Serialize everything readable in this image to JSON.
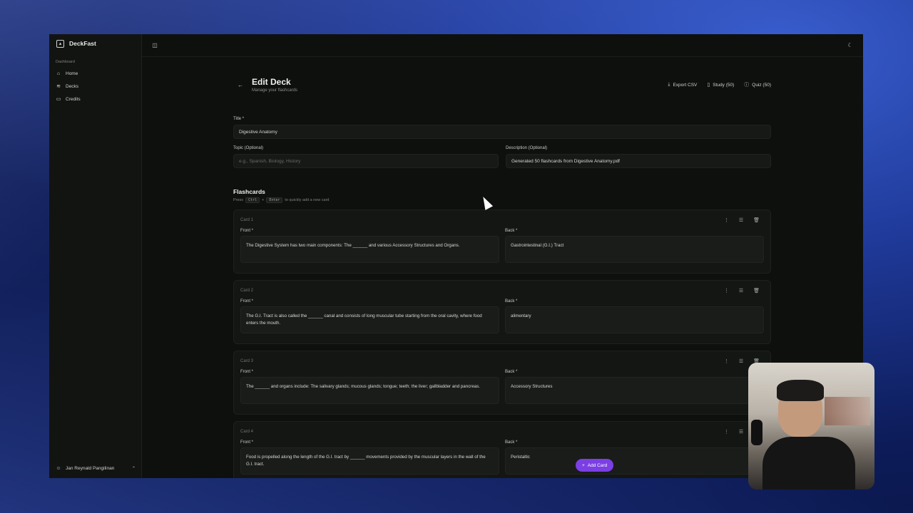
{
  "app": {
    "name": "DeckFast"
  },
  "sidebar": {
    "section_label": "Dashboard",
    "items": [
      {
        "label": "Home",
        "icon": "home-icon"
      },
      {
        "label": "Decks",
        "icon": "layers-icon"
      },
      {
        "label": "Credits",
        "icon": "credit-card-icon"
      }
    ],
    "user_name": "Jan Reynald Pangilinan"
  },
  "header": {
    "title": "Edit Deck",
    "subtitle": "Manage your flashcards",
    "actions": {
      "export": "Export CSV",
      "study": "Study (50)",
      "quiz": "Quiz (50)"
    }
  },
  "form": {
    "title_label": "Title *",
    "title_value": "Digestive Anatomy",
    "topic_label": "Topic (Optional)",
    "topic_placeholder": "e.g., Spanish, Biology, History",
    "description_label": "Description (Optional)",
    "description_value": "Generated 50 flashcards from Digestive Anatomy.pdf"
  },
  "flashcards": {
    "title": "Flashcards",
    "hint_prefix": "Press",
    "hint_key1": "Ctrl",
    "hint_plus": "+",
    "hint_key2": "Enter",
    "hint_suffix": "to quickly add a new card",
    "front_label": "Front *",
    "back_label": "Back *",
    "cards": [
      {
        "num": "Card 1",
        "front": "The Digestive System has two main components: The ______ and various Accessory Structures and Organs.",
        "back": "Gastrointestinal (G.I.) Tract"
      },
      {
        "num": "Card 2",
        "front": "The G.I. Tract is also called the ______ canal and consists of long muscular tube starting from the oral cavity, where food enters the mouth.",
        "back": "alimentary"
      },
      {
        "num": "Card 3",
        "front": "The ______ and organs include: The salivary glands; mucous glands; tongue; teeth; the liver; gallbladder and pancreas.",
        "back": "Accessory Structures"
      },
      {
        "num": "Card 4",
        "front": "Food is propelled along the length of the G.I. tract by ______ movements provided by the muscular layers in the wall of the G.I. tract.",
        "back": "Peristaltic"
      }
    ],
    "add_button": "Add Card"
  },
  "colors": {
    "accent": "#7b3fe4",
    "background": "#0e100e"
  }
}
